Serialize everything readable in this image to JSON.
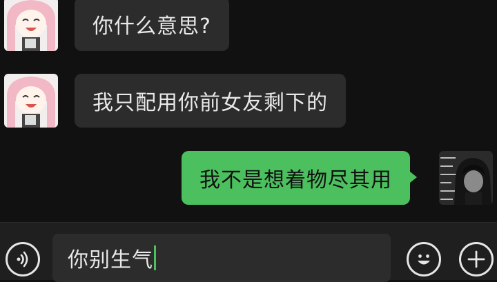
{
  "messages": [
    {
      "sender": "other",
      "avatar_icon": "pink-hair-girl-avatar",
      "text": "你什么意思?"
    },
    {
      "sender": "other",
      "avatar_icon": "pink-hair-girl-avatar",
      "text": "我只配用你前女友剩下的"
    },
    {
      "sender": "self",
      "avatar_icon": "dark-hair-boy-avatar",
      "text": "我不是想着物尽其用"
    }
  ],
  "input": {
    "value": "你别生气"
  },
  "colors": {
    "background": "#111111",
    "incoming_bubble": "#2c2c2c",
    "outgoing_bubble": "#4cc05f",
    "input_bar": "#1f1f1f"
  }
}
